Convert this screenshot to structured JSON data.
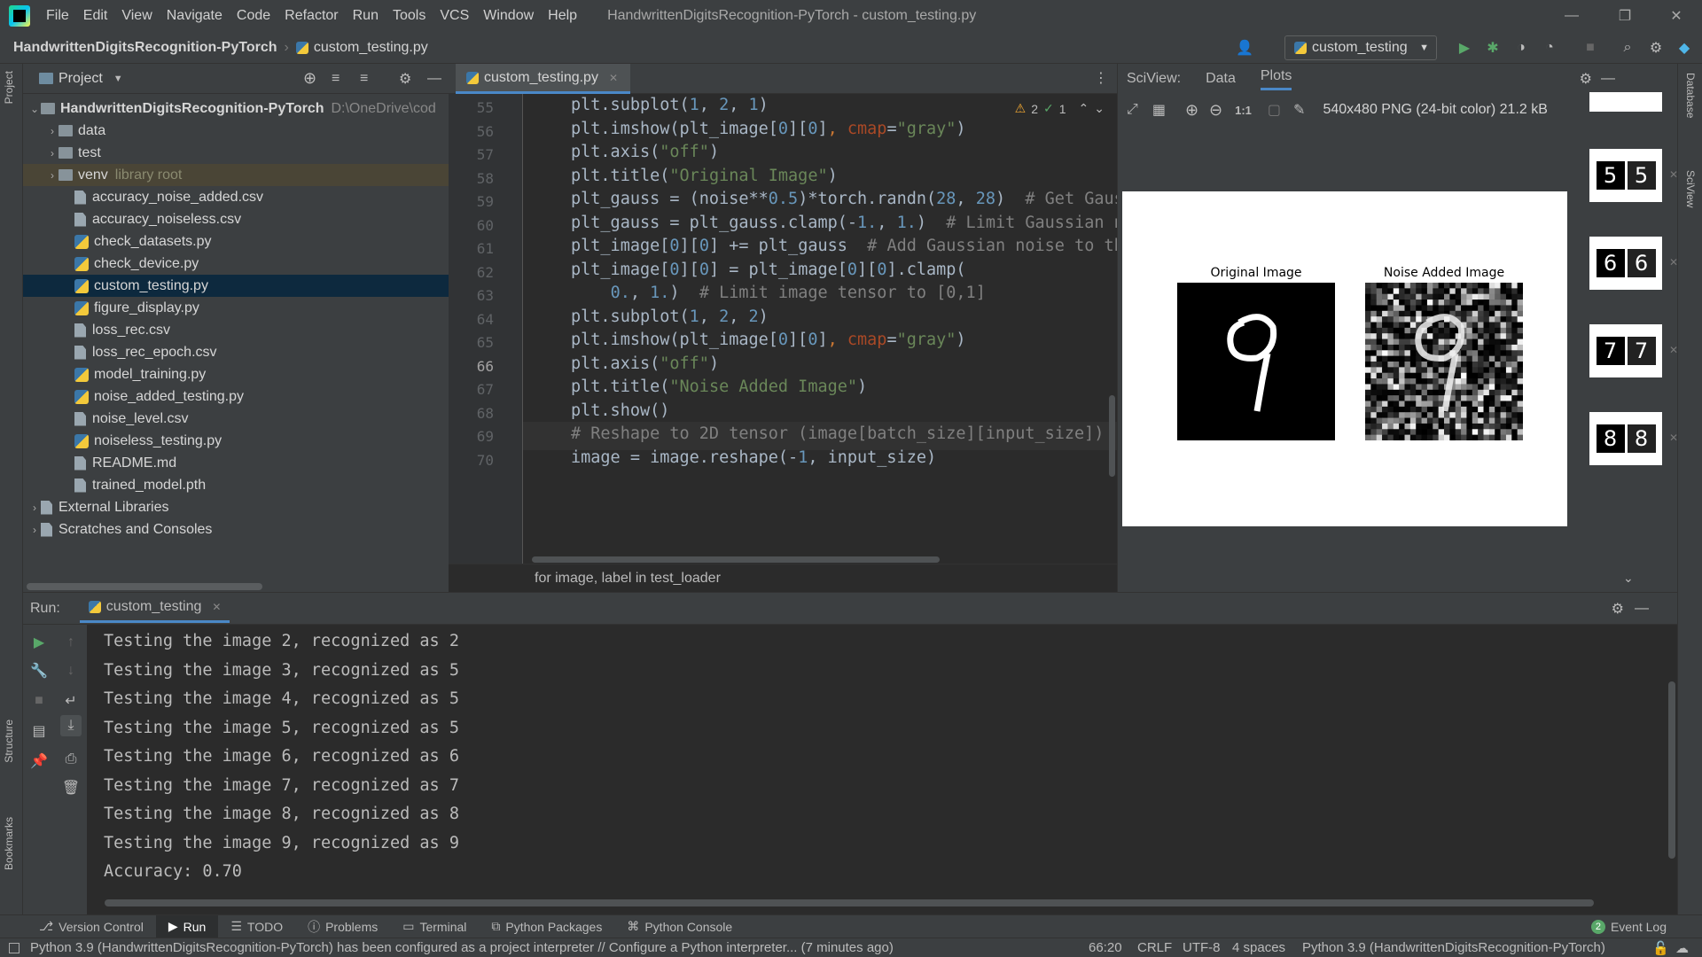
{
  "app": {
    "window_title": "HandwrittenDigitsRecognition-PyTorch - custom_testing.py",
    "menu": [
      "File",
      "Edit",
      "View",
      "Navigate",
      "Code",
      "Refactor",
      "Run",
      "Tools",
      "VCS",
      "Window",
      "Help"
    ]
  },
  "navbar": {
    "project": "HandwrittenDigitsRecognition-PyTorch",
    "file": "custom_testing.py",
    "run_config": "custom_testing"
  },
  "project_panel": {
    "title": "Project",
    "root": "HandwrittenDigitsRecognition-PyTorch",
    "root_path": "D:\\OneDrive\\cod",
    "items": [
      {
        "label": "data",
        "kind": "folder"
      },
      {
        "label": "test",
        "kind": "folder"
      },
      {
        "label": "venv",
        "kind": "folder",
        "note": "library root"
      },
      {
        "label": "accuracy_noise_added.csv",
        "kind": "file"
      },
      {
        "label": "accuracy_noiseless.csv",
        "kind": "file"
      },
      {
        "label": "check_datasets.py",
        "kind": "py"
      },
      {
        "label": "check_device.py",
        "kind": "py"
      },
      {
        "label": "custom_testing.py",
        "kind": "py"
      },
      {
        "label": "figure_display.py",
        "kind": "py"
      },
      {
        "label": "loss_rec.csv",
        "kind": "file"
      },
      {
        "label": "loss_rec_epoch.csv",
        "kind": "file"
      },
      {
        "label": "model_training.py",
        "kind": "py"
      },
      {
        "label": "noise_added_testing.py",
        "kind": "py"
      },
      {
        "label": "noise_level.csv",
        "kind": "file"
      },
      {
        "label": "noiseless_testing.py",
        "kind": "py"
      },
      {
        "label": "README.md",
        "kind": "file"
      },
      {
        "label": "trained_model.pth",
        "kind": "file"
      }
    ],
    "external_libraries": "External Libraries",
    "scratches": "Scratches and Consoles"
  },
  "editor": {
    "tab": "custom_testing.py",
    "inspections": {
      "warnings": "2",
      "ok": "1"
    },
    "lines": [
      {
        "no": "55",
        "html": "plt.subplot(<span class='n'>1</span>, <span class='n'>2</span>, <span class='n'>1</span>)"
      },
      {
        "no": "56",
        "html": "plt.imshow(plt_image[<span class='n'>0</span>][<span class='n'>0</span>]<span class='k'>, </span><span class='p'>cmap</span>=<span class='s'>\"gray\"</span>)"
      },
      {
        "no": "57",
        "html": "plt.axis(<span class='s'>\"off\"</span>)"
      },
      {
        "no": "58",
        "html": "plt.title(<span class='s'>\"Original Image\"</span>)"
      },
      {
        "no": "59",
        "html": "plt_gauss = (noise**<span class='n'>0.5</span>)*torch.randn(<span class='n'>28</span>, <span class='n'>28</span>)  <span class='c'># Get Gaus</span>"
      },
      {
        "no": "60",
        "html": "plt_gauss = plt_gauss.clamp(-<span class='n'>1.</span>, <span class='n'>1.</span>)  <span class='c'># Limit Gaussian n</span>"
      },
      {
        "no": "61",
        "html": "plt_image[<span class='n'>0</span>][<span class='n'>0</span>] += plt_gauss  <span class='c'># Add Gaussian noise to th</span>"
      },
      {
        "no": "62",
        "html": "plt_image[<span class='n'>0</span>][<span class='n'>0</span>] = plt_image[<span class='n'>0</span>][<span class='n'>0</span>].clamp("
      },
      {
        "no": "63",
        "html": "    <span class='n'>0.</span>, <span class='n'>1.</span>)  <span class='c'># Limit image tensor to [0,1]</span>"
      },
      {
        "no": "64",
        "html": "plt.subplot(<span class='n'>1</span>, <span class='n'>2</span>, <span class='n'>2</span>)"
      },
      {
        "no": "65",
        "html": "plt.imshow(plt_image[<span class='n'>0</span>][<span class='n'>0</span>]<span class='k'>, </span><span class='p'>cmap</span>=<span class='s'>\"gray\"</span>)"
      },
      {
        "no": "66",
        "html": "plt.axis(<span class='s'>\"off\"</span>)"
      },
      {
        "no": "67",
        "html": "plt.title(<span class='s'>\"Noise Added Image\"</span>)"
      },
      {
        "no": "68",
        "html": "plt.show()"
      },
      {
        "no": "69",
        "html": "<span class='c'># Reshape to 2D tensor (image[batch_size][input_size])</span>"
      },
      {
        "no": "70",
        "html": "image = image.reshape(-<span class='n'>1</span>, input_size)"
      }
    ],
    "breadcrumb": "for image, label in test_loader"
  },
  "sciview": {
    "label": "SciView:",
    "tabs": [
      "Data",
      "Plots"
    ],
    "image_info": "540x480 PNG (24-bit color) 21.2 kB",
    "zoom_label": "1:1",
    "plot_titles": [
      "Original Image",
      "Noise Added Image"
    ],
    "thumbnails": [
      [
        "5",
        "5"
      ],
      [
        "6",
        "6"
      ],
      [
        "7",
        "7"
      ],
      [
        "8",
        "8"
      ]
    ]
  },
  "run": {
    "label": "Run:",
    "tab": "custom_testing",
    "output": [
      "Testing the image 2, recognized as 2",
      "Testing the image 3, recognized as 5",
      "Testing the image 4, recognized as 5",
      "Testing the image 5, recognized as 5",
      "Testing the image 6, recognized as 6",
      "Testing the image 7, recognized as 7",
      "Testing the image 8, recognized as 8",
      "Testing the image 9, recognized as 9",
      "Accuracy: 0.70"
    ]
  },
  "bottom_tabs": [
    "Version Control",
    "Run",
    "TODO",
    "Problems",
    "Terminal",
    "Python Packages",
    "Python Console"
  ],
  "event_log": {
    "count": "2",
    "label": "Event Log"
  },
  "statusbar": {
    "message": "Python 3.9 (HandwrittenDigitsRecognition-PyTorch) has been configured as a project interpreter // Configure a Python interpreter... (7 minutes ago)",
    "position": "66:20",
    "line_sep": "CRLF",
    "encoding": "UTF-8",
    "indent": "4 spaces",
    "interpreter": "Python 3.9 (HandwrittenDigitsRecognition-PyTorch)"
  },
  "side_tabs": {
    "left": [
      "Project",
      "Structure",
      "Bookmarks"
    ],
    "right": [
      "Database",
      "SciView"
    ]
  }
}
